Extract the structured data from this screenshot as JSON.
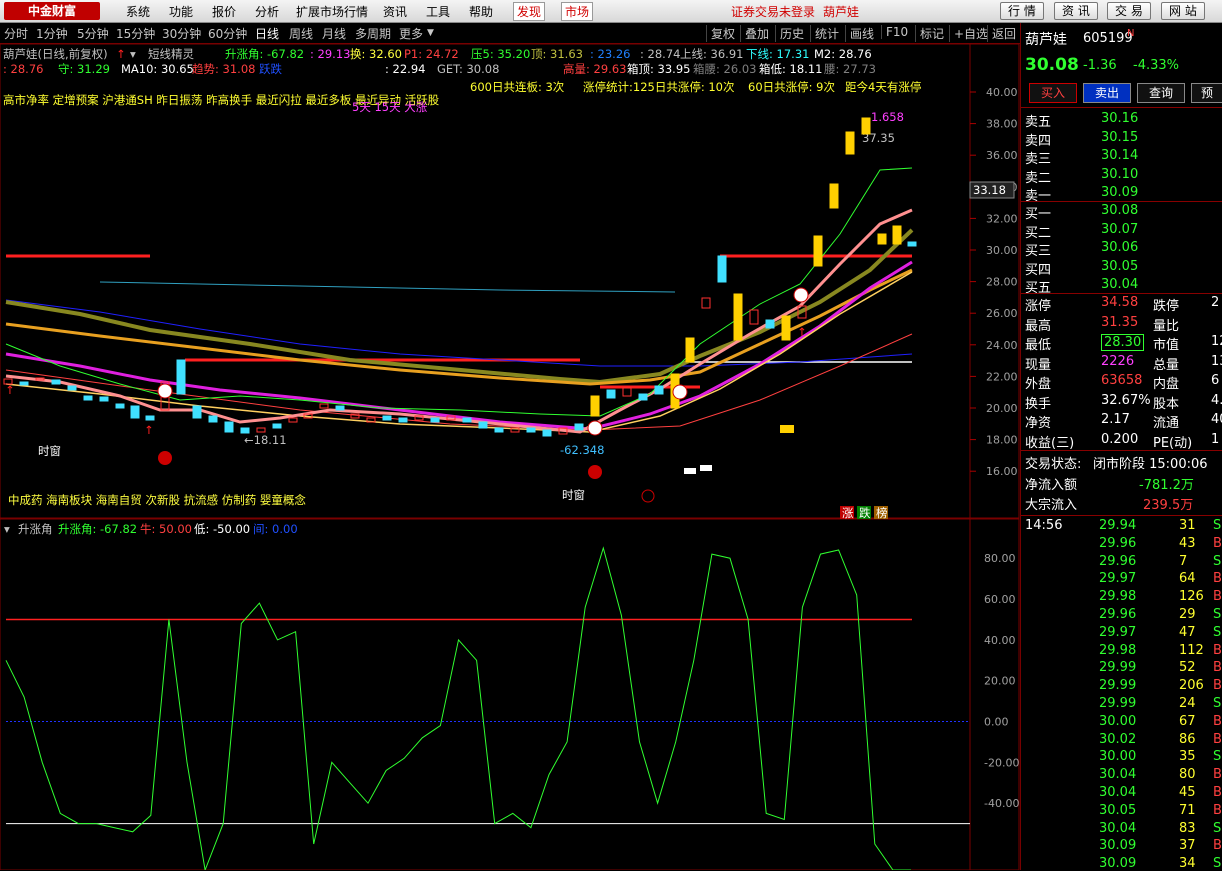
{
  "menubar": {
    "logo": "中金财富",
    "items": [
      "系统",
      "功能",
      "报价",
      "分析",
      "扩展市场行情",
      "资讯",
      "工具",
      "帮助"
    ],
    "highlight": [
      "发现",
      "市场"
    ],
    "notice": "证券交易未登录",
    "stock_link": "葫芦娃",
    "buttons": [
      "行 情",
      "资 讯",
      "交 易",
      "网 站"
    ]
  },
  "periods": [
    "分时",
    "1分钟",
    "5分钟",
    "15分钟",
    "30分钟",
    "60分钟",
    "日线",
    "周线",
    "月线",
    "多周期",
    "更多"
  ],
  "active_period": "日线",
  "tools": [
    "复权",
    "叠加",
    "历史",
    "统计",
    "画线",
    "F10",
    "标记",
    "+自选",
    "返回"
  ],
  "kline_header": {
    "name": "葫芦娃(日线,前复权)",
    "indicator": "短线精灵",
    "rise_angle": "升涨角: -67.82",
    "v1": ": 29.13",
    "swap": "换: 32.60",
    "p1": "P1: 24.72",
    "pressure": "压5: 35.20",
    "top": "顶: 31.63",
    "v2": ": 23.26",
    "v3": ": 28.74",
    "upper": "上线: 36.91",
    "lower": "下线: 17.31",
    "m2": "M2: 28.76",
    "row2_a": ": 28.76",
    "guard": "守: 31.29",
    "ma10": "MA10: 30.65",
    "trend": "趋势: 31.08",
    "jump": "跃跌",
    "v4": ": 22.94",
    "get": "GET: 30.08",
    "high": "高量: 29.63",
    "box_top": "箱顶: 33.95",
    "box_bottom": "箱腰: 26.03",
    "box_base": "箱低: 18.11",
    "waist": "腰: 27.73",
    "tags": "高市净率 定增预案 沪港通SH 昨日振荡 昨高换手 最近闪拉 最近多板 最近异动 活跃股",
    "stat1": "600日共连板: 3次",
    "stat2": "涨停统计:125日共涨停: 10次",
    "stat3": "60日共涨停: 9次",
    "stat4": "距今4天有涨停",
    "stat5": "5天 15天 大涨",
    "concepts": "中成药 海南板块 海南自贸 次新股 抗流感 仿制药 婴童概念",
    "time_window": "时窗",
    "time_window2": "时窗",
    "ann_low": "←18.11",
    "ann_low2": "-62.348",
    "ann_high": "37.35",
    "ann_high2": "1.658",
    "price_flag": "33.18",
    "limit_tags": [
      "涨",
      "跌",
      "榜"
    ]
  },
  "price_axis": [
    "40.00",
    "38.00",
    "36.00",
    "34.00",
    "32.00",
    "30.00",
    "28.00",
    "26.00",
    "24.00",
    "22.00",
    "20.00",
    "18.00",
    "16.00"
  ],
  "sub_header": {
    "name": "升涨角",
    "angle": "升涨角: -67.82",
    "cow": "牛: 50.00",
    "low": "低: -50.00",
    "mid": "间: 0.00"
  },
  "sub_axis": [
    "80.00",
    "60.00",
    "40.00",
    "20.00",
    "0.00",
    "-20.00",
    "-40.00"
  ],
  "chart_data": {
    "type": "line",
    "title": "升涨角",
    "ylim": [
      -60,
      85
    ],
    "series": [
      {
        "name": "升涨角",
        "values": [
          30,
          12,
          -20,
          -45,
          -50,
          -50,
          -52,
          -54,
          -46,
          50,
          -20,
          -78,
          -50,
          48,
          58,
          40,
          44,
          -60,
          -20,
          -30,
          -40,
          -24,
          -18,
          -8,
          -2,
          40,
          30,
          -50,
          -45,
          -52,
          -26,
          -10,
          56,
          85,
          52,
          -10,
          -40,
          -10,
          30,
          82,
          80,
          50,
          -45,
          -48,
          56,
          82,
          84,
          62,
          -60,
          -85,
          -80
        ]
      },
      {
        "name": "牛",
        "values": [
          50
        ]
      },
      {
        "name": "低",
        "values": [
          -50
        ]
      },
      {
        "name": "间",
        "values": [
          0
        ]
      }
    ]
  },
  "quote": {
    "name": "葫芦娃",
    "code": "605199",
    "flag": "N",
    "price": "30.08",
    "change": "-1.36",
    "pct": "-4.33%",
    "buttons": [
      "买入",
      "卖出",
      "查询",
      "预"
    ],
    "asks": [
      [
        "卖五",
        "30.16"
      ],
      [
        "卖四",
        "30.15"
      ],
      [
        "卖三",
        "30.14"
      ],
      [
        "卖二",
        "30.10"
      ],
      [
        "卖一",
        "30.09"
      ]
    ],
    "bids": [
      [
        "买一",
        "30.08"
      ],
      [
        "买二",
        "30.07"
      ],
      [
        "买三",
        "30.06"
      ],
      [
        "买四",
        "30.05"
      ],
      [
        "买五",
        "30.04"
      ]
    ],
    "stats": [
      [
        "涨停",
        "34.58",
        "跌停",
        "2"
      ],
      [
        "最高",
        "31.35",
        "量比",
        ""
      ],
      [
        "最低",
        "28.30",
        "市值",
        "12"
      ],
      [
        "现量",
        "2226",
        "总量",
        "13"
      ],
      [
        "外盘",
        "63658",
        "内盘",
        "6"
      ],
      [
        "换手",
        "32.67%",
        "股本",
        "4."
      ],
      [
        "净资",
        "2.17",
        "流通",
        "40"
      ],
      [
        "收益(三)",
        "0.200",
        "PE(动)",
        "1"
      ]
    ],
    "trade_state_label": "交易状态:",
    "trade_state": "闭市阶段 15:00:06",
    "net_inflow_label": "净流入额",
    "net_inflow": "-781.2万",
    "block_inflow_label": "大宗流入",
    "block_inflow": "239.5万",
    "ticks": [
      [
        "14:56",
        "29.94",
        "31",
        "S"
      ],
      [
        "",
        "29.96",
        "43",
        "B"
      ],
      [
        "",
        "29.96",
        "7",
        "S"
      ],
      [
        "",
        "29.97",
        "64",
        "B"
      ],
      [
        "",
        "29.98",
        "126",
        "B"
      ],
      [
        "",
        "29.96",
        "29",
        "S"
      ],
      [
        "",
        "29.97",
        "47",
        "S"
      ],
      [
        "",
        "29.98",
        "112",
        "B"
      ],
      [
        "",
        "29.99",
        "52",
        "B"
      ],
      [
        "",
        "29.99",
        "206",
        "B"
      ],
      [
        "",
        "29.99",
        "24",
        "S"
      ],
      [
        "",
        "30.00",
        "67",
        "B"
      ],
      [
        "",
        "30.02",
        "86",
        "B"
      ],
      [
        "",
        "30.00",
        "35",
        "S"
      ],
      [
        "",
        "30.04",
        "80",
        "B"
      ],
      [
        "",
        "30.04",
        "45",
        "B"
      ],
      [
        "",
        "30.05",
        "71",
        "B"
      ],
      [
        "",
        "30.04",
        "83",
        "S"
      ],
      [
        "",
        "30.09",
        "37",
        "B"
      ],
      [
        "",
        "30.09",
        "34",
        "S"
      ]
    ]
  }
}
